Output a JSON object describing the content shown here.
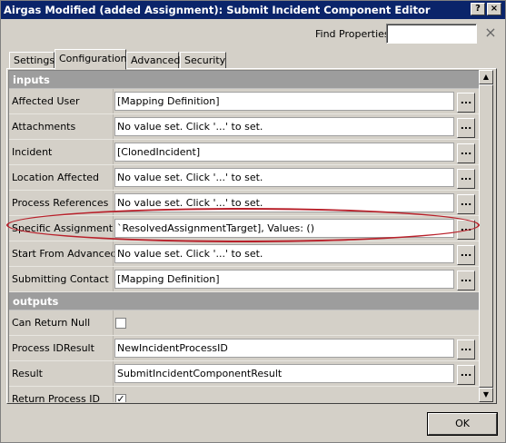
{
  "window": {
    "title": "Airgas Modified (added Assignment): Submit Incident Component Editor",
    "help_label": "?",
    "close_label": "×"
  },
  "find": {
    "label": "Find Properties",
    "value": "",
    "clear_icon": "×"
  },
  "tabs": [
    {
      "label": "Settings",
      "active": false
    },
    {
      "label": "Configuration",
      "active": true
    },
    {
      "label": "Advanced",
      "active": false
    },
    {
      "label": "Security",
      "active": false
    }
  ],
  "sections": {
    "inputs": {
      "label": "inputs",
      "rows": [
        {
          "label": "Affected User",
          "value": "[Mapping Definition]",
          "button": "..."
        },
        {
          "label": "Attachments",
          "value": "No value set. Click '...' to set.",
          "button": "..."
        },
        {
          "label": "Incident",
          "value": "[ClonedIncident]",
          "button": "..."
        },
        {
          "label": "Location Affected",
          "value": "No value set. Click '...' to set.",
          "button": "..."
        },
        {
          "label": "Process References",
          "value": "No value set. Click '...' to set.",
          "button": "..."
        },
        {
          "label": "Specific Assignment",
          "value": "`ResolvedAssignmentTarget], Values: ()",
          "button": "..."
        },
        {
          "label": "Start From Advanced",
          "value": "No value set. Click '...' to set.",
          "button": "..."
        },
        {
          "label": "Submitting Contact",
          "value": "[Mapping Definition]",
          "button": "..."
        }
      ]
    },
    "outputs": {
      "label": "outputs",
      "rows": [
        {
          "label": "Can Return Null",
          "checked": false
        },
        {
          "label": "Process IDResult",
          "value": "NewIncidentProcessID",
          "button": "..."
        },
        {
          "label": "Result",
          "value": "SubmitIncidentComponentResult",
          "button": "..."
        },
        {
          "label": "Return Process ID",
          "checked": true,
          "check_glyph": "✓"
        }
      ]
    }
  },
  "scrollbar": {
    "up_icon": "▲",
    "down_icon": "▼"
  },
  "ok_label": "OK",
  "colors": {
    "title_bar": "#0a246a",
    "section_header": "#9d9d9d",
    "highlight": "#b8202a"
  }
}
